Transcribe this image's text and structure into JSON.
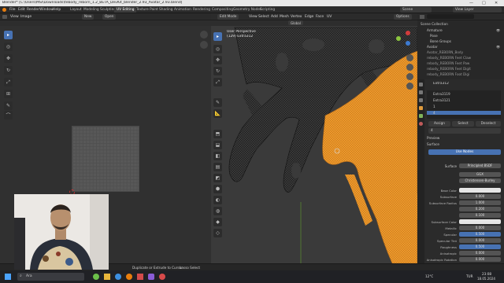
{
  "window": {
    "title": "Blender* [C:\\Users\\MSI\\Downloads\\tebody_reborn_1.2_BETA_DevKit_blender_2.93_Avatar_2.93.blend]",
    "controls": [
      "—",
      "□",
      "✕"
    ]
  },
  "menu": [
    "File",
    "Edit",
    "Render",
    "Window",
    "Help"
  ],
  "workspaces": [
    "Layout",
    "Modeling",
    "Sculpting",
    "UV Editing",
    "Texture Paint",
    "Shading",
    "Animation",
    "Rendering",
    "Compositing",
    "Geometry Nodes",
    "Scripting"
  ],
  "active_workspace": "UV Editing",
  "scene": {
    "label": "Scene",
    "view_layer": "View Layer"
  },
  "image_editor": {
    "view": "View",
    "image": "Image",
    "new_button": "New",
    "open_button": "Open"
  },
  "viewport": {
    "mode": "Edit Mode",
    "menus": [
      "View",
      "Select",
      "Add",
      "Mesh",
      "Vertex",
      "Edge",
      "Face",
      "UV"
    ],
    "transform": "Global",
    "options": "Options",
    "overlay_title": "User Perspective",
    "overlay_object": "(129) Extra312"
  },
  "outliner": {
    "title": "Scene Collection",
    "items": [
      "Armature",
      "Pose",
      "Bone Groups",
      "Avatar",
      "Avatar_REBORN_Body",
      "rebody_REBORN Feet Claw",
      "rebody_REBORN Feet Paw",
      "rebody_REBORN Feet Digit",
      "rebody_REBORN Foot Digi"
    ]
  },
  "properties": {
    "object_name": "Extra312",
    "material_slots": [
      "Extra3119",
      "Extra3121",
      "1",
      "4"
    ],
    "assign": "Assign",
    "select": "Select",
    "deselect": "Deselect",
    "material_name": "4",
    "preview": "Preview",
    "surface_panel": "Surface",
    "use_nodes": "Use Nodes",
    "surface_label": "Surface",
    "surface_value": "Principled BSDF",
    "distribution": "GGX",
    "subsurface_method": "Christensen-Burley",
    "fields": [
      {
        "label": "Base Color",
        "value": "",
        "kind": "white"
      },
      {
        "label": "Subsurface",
        "value": "0.000",
        "kind": "gray"
      },
      {
        "label": "Subsurface Radius",
        "value": "1.000",
        "kind": "gray"
      },
      {
        "label": "",
        "value": "0.200",
        "kind": "gray"
      },
      {
        "label": "",
        "value": "0.100",
        "kind": "gray"
      },
      {
        "label": "Subsurface Color",
        "value": "",
        "kind": "white"
      },
      {
        "label": "Metallic",
        "value": "0.000",
        "kind": "gray"
      },
      {
        "label": "Specular",
        "value": "0.500",
        "kind": "blue"
      },
      {
        "label": "Specular Tint",
        "value": "0.000",
        "kind": "gray"
      },
      {
        "label": "Roughness",
        "value": "0.500",
        "kind": "blue"
      },
      {
        "label": "Anisotropic",
        "value": "0.000",
        "kind": "gray"
      },
      {
        "label": "Anisotropic Rotation",
        "value": "0.000",
        "kind": "gray"
      },
      {
        "label": "Sheen",
        "value": "0.000",
        "kind": "gray"
      }
    ]
  },
  "statusbar": {
    "select": "Select",
    "duplicate": "Duplicate or Extrude to Cursor",
    "lasso": "Lasso Select"
  },
  "taskbar": {
    "search": "Ara",
    "weather": "12°C",
    "lang": "TUR",
    "time": "23:08",
    "date": "18.05.2024"
  },
  "colors": {
    "accent": "#4772b3",
    "mesh_selected": "#f19a2a",
    "viewport_bg": "#3a3a3a"
  }
}
